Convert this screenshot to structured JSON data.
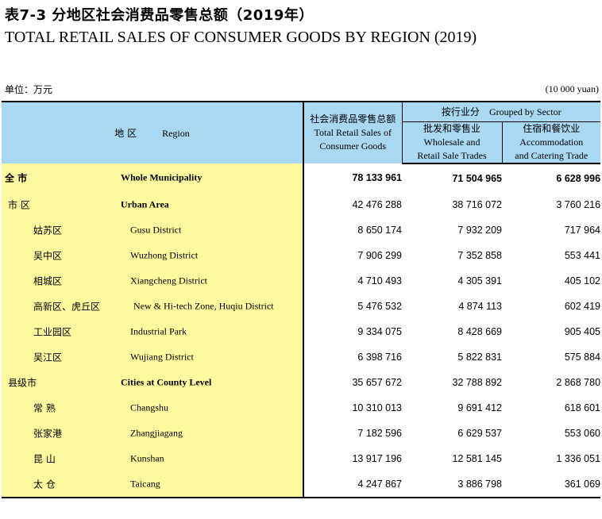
{
  "title": {
    "cn": "表7-3  分地区社会消费品零售总额（2019年）",
    "en": "TOTAL RETAIL SALES OF CONSUMER GOODS BY REGION (2019)"
  },
  "unit": {
    "cn": "单位：万元",
    "en": "(10 000 yuan)"
  },
  "header": {
    "region_cn": "地 区",
    "region_en": "Region",
    "total_cn": "社会消费品零售总额",
    "total_en_line1": "Total Retail Sales of",
    "total_en_line2": "Consumer Goods",
    "group_cn": "按行业分",
    "group_en": "Grouped by Sector",
    "wholesale_cn": "批发和零售业",
    "wholesale_en_line1": "Wholesale and",
    "wholesale_en_line2": "Retail Sale Trades",
    "accom_cn": "住宿和餐饮业",
    "accom_en_line1": "Accommodation",
    "accom_en_line2": "and Catering Trade"
  },
  "rows": [
    {
      "cn": "全  市",
      "en": "Whole Municipality",
      "total": "78 133 961",
      "wholesale": "71 504 965",
      "accommodation": "6 628 996"
    },
    {
      "cn": "市 区",
      "en": "Urban Area",
      "total": "42 476 288",
      "wholesale": "38 716 072",
      "accommodation": "3 760 216"
    },
    {
      "cn": "姑苏区",
      "en": "Gusu District",
      "total": "8 650 174",
      "wholesale": "7 932 209",
      "accommodation": "717 964"
    },
    {
      "cn": "吴中区",
      "en": "Wuzhong District",
      "total": "7 906 299",
      "wholesale": "7 352 858",
      "accommodation": "553 441"
    },
    {
      "cn": "相城区",
      "en": "Xiangcheng District",
      "total": "4 710 493",
      "wholesale": "4 305 391",
      "accommodation": "405 102"
    },
    {
      "cn": "高新区、虎丘区",
      "en": "New & Hi-tech Zone, Huqiu District",
      "total": "5 476 532",
      "wholesale": "4 874 113",
      "accommodation": "602 419"
    },
    {
      "cn": "工业园区",
      "en": "Industrial Park",
      "total": "9 334 075",
      "wholesale": "8 428 669",
      "accommodation": "905 405"
    },
    {
      "cn": "吴江区",
      "en": "Wujiang District",
      "total": "6 398 716",
      "wholesale": "5 822 831",
      "accommodation": "575 884"
    },
    {
      "cn": "县级市",
      "en": "Cities at County Level",
      "total": "35 657 672",
      "wholesale": "32 788 892",
      "accommodation": "2 868 780"
    },
    {
      "cn": "常  熟",
      "en": "Changshu",
      "total": "10 310 013",
      "wholesale": "9 691 412",
      "accommodation": "618 601"
    },
    {
      "cn": "张家港",
      "en": "Zhangjiagang",
      "total": "7 182 596",
      "wholesale": "6 629 537",
      "accommodation": "553 060"
    },
    {
      "cn": "昆  山",
      "en": "Kunshan",
      "total": "13 917 196",
      "wholesale": "12 581 145",
      "accommodation": "1 336 051"
    },
    {
      "cn": "太  仓",
      "en": "Taicang",
      "total": "4 247 867",
      "wholesale": "3 886 798",
      "accommodation": "361 069"
    }
  ],
  "colors": {
    "header_bg": "#a9d8f2",
    "region_bg": "#fffaa0"
  }
}
